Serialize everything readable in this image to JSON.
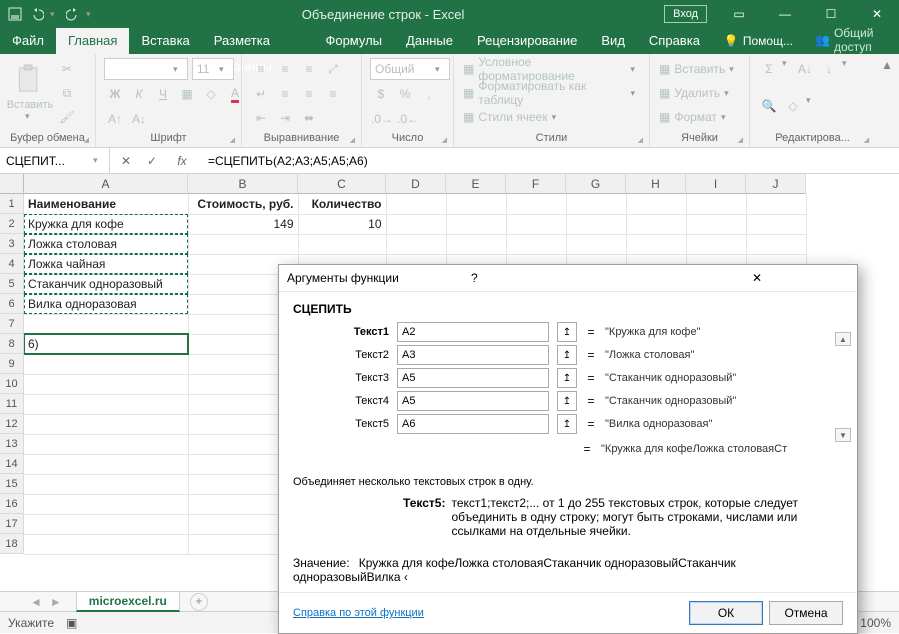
{
  "titlebar": {
    "title": "Объединение строк  -  Excel",
    "login": "Вход"
  },
  "tabs": [
    "Файл",
    "Главная",
    "Вставка",
    "Разметка страницы",
    "Формулы",
    "Данные",
    "Рецензирование",
    "Вид",
    "Справка"
  ],
  "help_hint": "Помощ...",
  "share": "Общий доступ",
  "ribbon": {
    "paste": "Вставить",
    "groups": [
      "Буфер обмена",
      "Шрифт",
      "Выравнивание",
      "Число",
      "Стили",
      "Ячейки",
      "Редактирова..."
    ],
    "font_size": "11",
    "num_fmt": "Общий",
    "styles": [
      "Условное форматирование",
      "Форматировать как таблицу",
      "Стили ячеек"
    ],
    "cells": [
      "Вставить",
      "Удалить",
      "Формат"
    ]
  },
  "namebox": "СЦЕПИТ...",
  "formula": "=СЦЕПИТЬ(A2;A3;A5;A5;A6)",
  "cols": [
    "A",
    "B",
    "C",
    "D",
    "E",
    "F",
    "G",
    "H",
    "I",
    "J"
  ],
  "rows": [
    "1",
    "2",
    "3",
    "4",
    "5",
    "6",
    "7",
    "8",
    "9",
    "10",
    "11",
    "12",
    "13",
    "14",
    "15",
    "16",
    "17",
    "18"
  ],
  "cells": {
    "A1": "Наименование",
    "B1": "Стоимость, руб.",
    "C1": "Количество",
    "A2": "Кружка для кофе",
    "B2": "149",
    "C2": "10",
    "A3": "Ложка столовая",
    "A4": "Ложка чайная",
    "A5": "Стаканчик одноразовый",
    "A6": "Вилка одноразовая",
    "A8": "6)"
  },
  "dialog": {
    "title": "Аргументы функции",
    "fn": "СЦЕПИТЬ",
    "args": [
      {
        "label": "Текст1",
        "value": "A2",
        "result": "\"Кружка для кофе\""
      },
      {
        "label": "Текст2",
        "value": "A3",
        "result": "\"Ложка столовая\""
      },
      {
        "label": "Текст3",
        "value": "A5",
        "result": "\"Стаканчик одноразовый\""
      },
      {
        "label": "Текст4",
        "value": "A5",
        "result": "\"Стаканчик одноразовый\""
      },
      {
        "label": "Текст5",
        "value": "A6",
        "result": "\"Вилка одноразовая\""
      }
    ],
    "partial": "\"Кружка для кофеЛожка столоваяСт",
    "desc": "Объединяет несколько текстовых строк в одну.",
    "argdesc_label": "Текст5:",
    "argdesc": "текст1;текст2;... от 1 до 255 текстовых строк, которые следует объединить в одну строку; могут быть строками, числами или ссылками на отдельные ячейки.",
    "value_label": "Значение:",
    "value": "Кружка для кофеЛожка столоваяСтаканчик одноразовыйСтаканчик одноразовыйВилка ‹",
    "help": "Справка по этой функции",
    "ok": "ОК",
    "cancel": "Отмена"
  },
  "sheet": {
    "name": "microexcel.ru"
  },
  "status": {
    "mode": "Укажите",
    "zoom": "100%"
  }
}
